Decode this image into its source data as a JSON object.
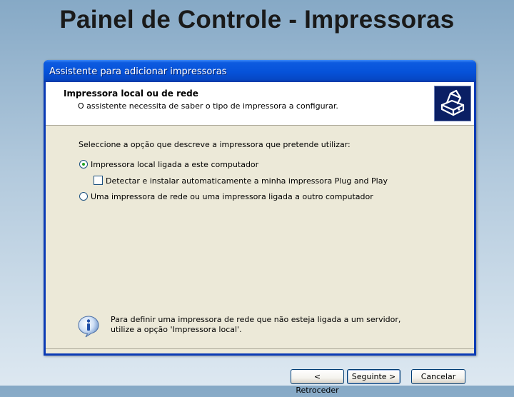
{
  "slide": {
    "title": "Painel de Controle - Impressoras"
  },
  "window": {
    "title": "Assistente para adicionar impressoras"
  },
  "header": {
    "title": "Impressora local ou de rede",
    "subtitle": "O assistente necessita de saber o tipo de impressora a configurar.",
    "icon": "printer-icon"
  },
  "main": {
    "prompt": "Seleccione a opção que descreve a impressora que pretende utilizar:",
    "option_local": {
      "label": "Impressora local ligada a este computador",
      "selected": true
    },
    "checkbox_pnp": {
      "label": "Detectar e instalar automaticamente a minha impressora Plug and Play",
      "checked": false
    },
    "option_network": {
      "label": "Uma impressora de rede ou uma impressora ligada a outro computador",
      "selected": false
    },
    "info": {
      "icon": "info-icon",
      "line1": "Para definir uma impressora de rede que não esteja ligada a um servidor,",
      "line2": "utilize a opção 'Impressora local'."
    }
  },
  "buttons": {
    "back": "< Retroceder",
    "next": "Seguinte >",
    "cancel": "Cancelar"
  },
  "colors": {
    "titlebar": "#0652d9",
    "dialog_bg": "#ece9d8",
    "radio_dot": "#21a121"
  }
}
